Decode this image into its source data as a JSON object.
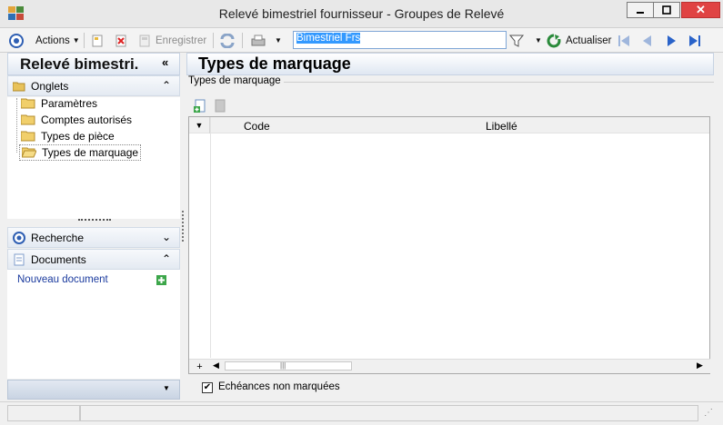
{
  "window": {
    "title": "Relevé bimestriel fournisseur -  Groupes de Relevé",
    "close_glyph": "✕"
  },
  "toolbar": {
    "actions_label": "Actions",
    "save_label": "Enregistrer",
    "search_value": "Bimestriel Frs",
    "refresh_label": "Actualiser"
  },
  "left": {
    "title": "Relevé bimestri.",
    "collapse_glyph": "«",
    "tabs_header": "Onglets",
    "tree_items": [
      "Paramètres",
      "Comptes autorisés",
      "Types de pièce",
      "Types de marquage"
    ],
    "search_header": "Recherche",
    "documents_header": "Documents",
    "new_document_label": "Nouveau document"
  },
  "main": {
    "title": "Types de marquage",
    "group_label": "Types de marquage",
    "columns": [
      "Code",
      "Libellé"
    ],
    "rows": [],
    "checkbox_label": "Echéances non marquées",
    "checkbox_checked": true
  },
  "colors": {
    "accent": "#3399ff",
    "header_gradient_top": "#ffffff",
    "header_gradient_bottom": "#dfe7f2",
    "link": "#1a3a9e"
  }
}
